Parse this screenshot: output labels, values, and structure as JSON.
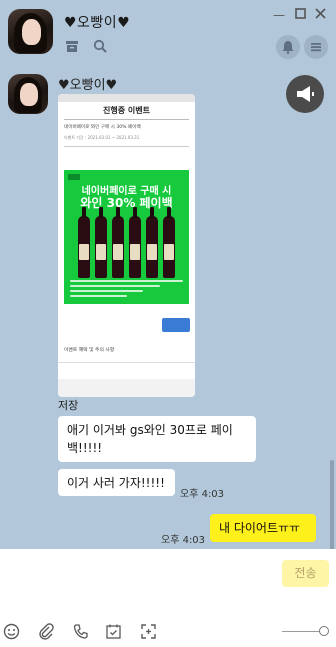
{
  "header": {
    "title": "♥오빵이♥",
    "window_controls": [
      "minimize",
      "maximize",
      "close"
    ]
  },
  "chat": {
    "sender_name": "♥오빵이♥",
    "shared_image": {
      "page_title": "진행중 이벤트",
      "headline": "네이버페이로 와인 구매 시 30% 페이백",
      "period": "이벤트 기간 : 2021.03.01 ~ 2021.03.31",
      "promo_line1": "네이버페이로 구매 시",
      "promo_line2": "와인 30% 페이백",
      "notice": "이벤트 혜택 및 주의 사항"
    },
    "saved_label": "저장",
    "messages": [
      {
        "direction": "in",
        "text": "애기 이거봐 gs와인 30프로 페이백!!!!!",
        "time": ""
      },
      {
        "direction": "in",
        "text": "이거 사러 가자!!!!!",
        "time": "오후 4:03"
      },
      {
        "direction": "out",
        "text": "내 다이어트ㅠㅠ",
        "time": "오후 4:03"
      }
    ]
  },
  "input": {
    "send_label": "전송"
  },
  "colors": {
    "chat_bg": "#b2c7d9",
    "out_bubble": "#fef01b",
    "in_bubble": "#ffffff",
    "send_disabled": "#fef5a6"
  }
}
